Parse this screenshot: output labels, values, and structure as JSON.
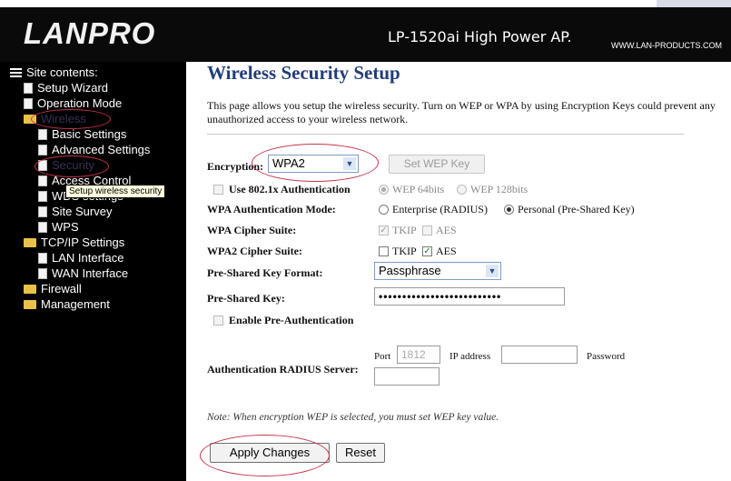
{
  "header": {
    "logo": "LANPRO",
    "model": "LP-1520ai High Power AP.",
    "site": "WWW.LAN-PRODUCTS.COM"
  },
  "sidebar": {
    "title": "Site contents:",
    "items": [
      {
        "label": "Setup Wizard"
      },
      {
        "label": "Operation Mode"
      },
      {
        "label": "Wireless"
      },
      {
        "label": "Basic Settings"
      },
      {
        "label": "Advanced Settings"
      },
      {
        "label": "Security"
      },
      {
        "label": "Access Control"
      },
      {
        "label": "WDS settings"
      },
      {
        "label": "Site Survey"
      },
      {
        "label": "WPS"
      },
      {
        "label": "TCP/IP Settings"
      },
      {
        "label": "LAN Interface"
      },
      {
        "label": "WAN Interface"
      },
      {
        "label": "Firewall"
      },
      {
        "label": "Management"
      }
    ],
    "tooltip": "Setup wireless security"
  },
  "main": {
    "title": "Wireless Security Setup",
    "intro": "This page allows you setup the wireless security. Turn on WEP or WPA by using Encryption Keys could prevent any unauthorized access to your wireless network.",
    "encryption_label": "Encryption:",
    "encryption_value": "WPA2",
    "set_wep_key": "Set WEP Key",
    "use_8021x": "Use 802.1x Authentication",
    "wep64": "WEP 64bits",
    "wep128": "WEP 128bits",
    "wpa_auth_label": "WPA Authentication Mode:",
    "auth_enterprise": "Enterprise (RADIUS)",
    "auth_personal": "Personal (Pre-Shared Key)",
    "wpa_cipher_label": "WPA Cipher Suite:",
    "wpa2_cipher_label": "WPA2 Cipher Suite:",
    "tkip": "TKIP",
    "aes": "AES",
    "psk_format_label": "Pre-Shared Key Format:",
    "psk_format_value": "Passphrase",
    "psk_label": "Pre-Shared Key:",
    "psk_value": "••••••••••••••••••••••••••",
    "pre_auth": "Enable Pre-Authentication",
    "radius_label": "Authentication RADIUS Server:",
    "port_label": "Port",
    "port_value": "1812",
    "ip_label": "IP address",
    "password_label": "Password",
    "note": "Note: When encryption WEP is selected, you must set WEP key value.",
    "apply": "Apply Changes",
    "reset": "Reset"
  }
}
